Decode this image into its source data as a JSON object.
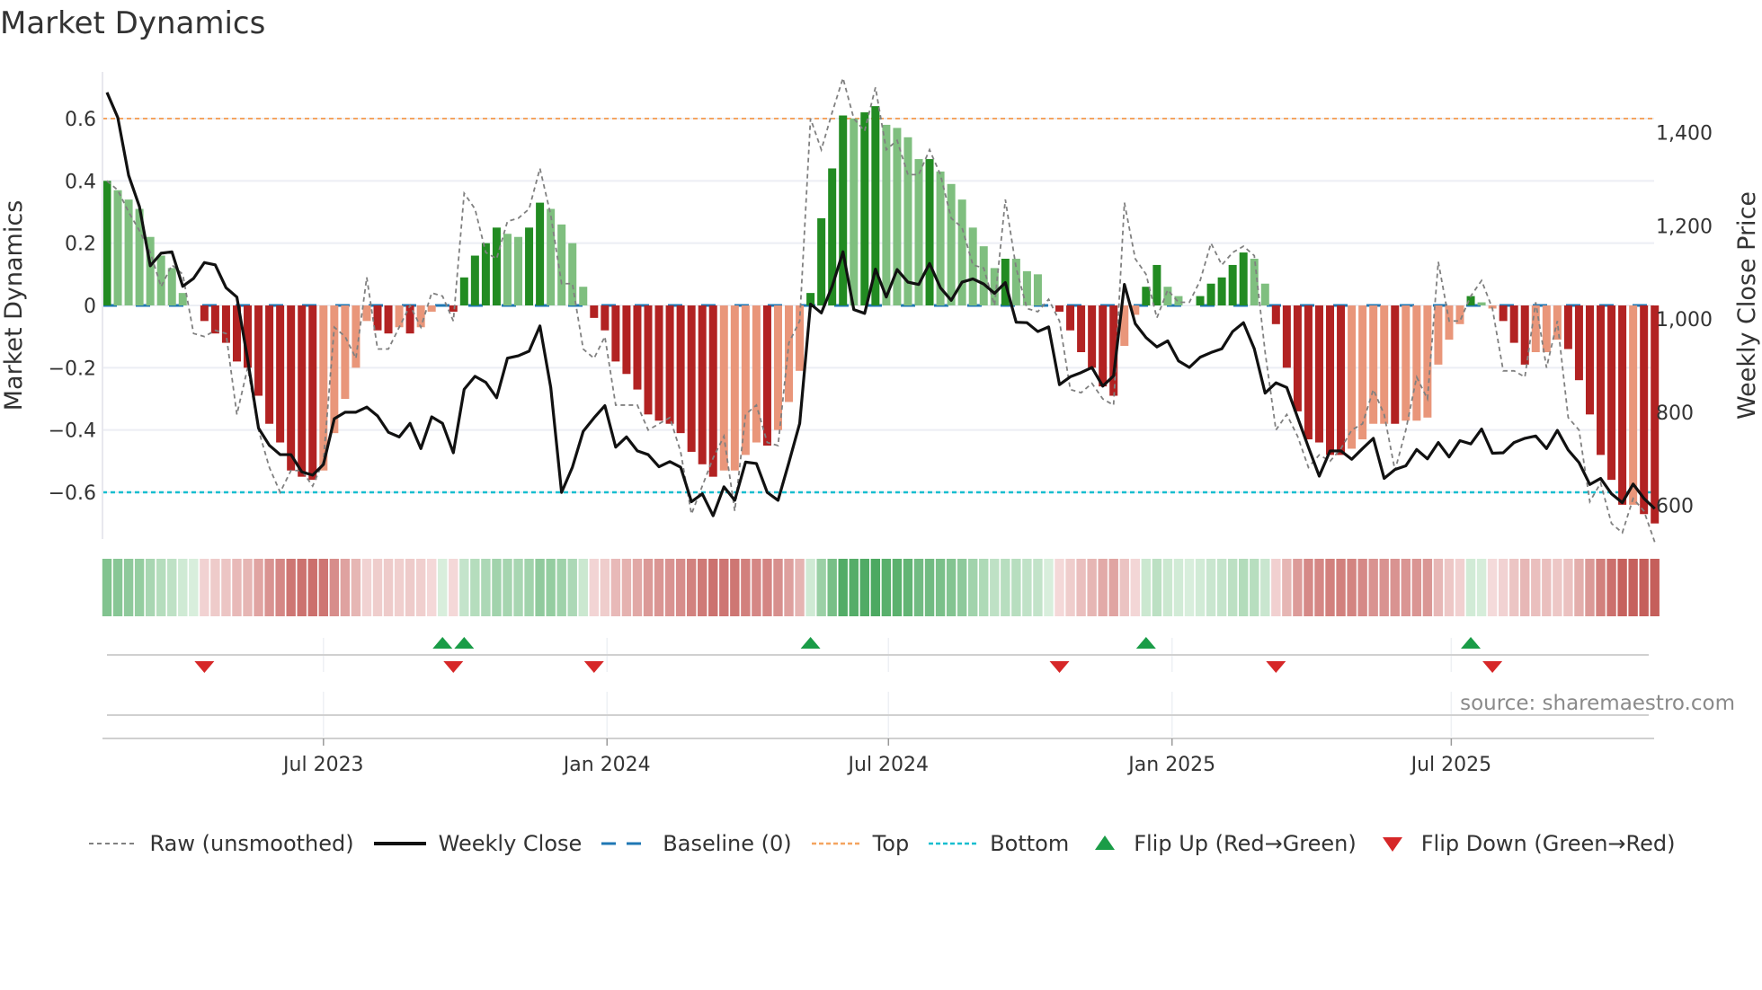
{
  "title": "Market Dynamics",
  "source": "source: sharemaestro.com",
  "legend": {
    "raw": "Raw (unsmoothed)",
    "close": "Weekly Close",
    "baseline": "Baseline (0)",
    "top": "Top",
    "bottom": "Bottom",
    "flip_up": "Flip Up (Red→Green)",
    "flip_down": "Flip Down (Green→Red)"
  },
  "colors": {
    "green_strong": "#228b22",
    "green_weak": "#7fbf7f",
    "red_strong": "#b22222",
    "red_weak": "#e9967a",
    "close": "#111111",
    "raw": "#808080",
    "baseline": "#1f77b4",
    "top": "#f4a460",
    "bottom": "#17becf",
    "flip_up": "#1a9c47",
    "flip_down": "#d62728"
  },
  "chart_data": {
    "type": "bar",
    "title": "Market Dynamics",
    "ylabel": "Market Dynamics",
    "y2label": "Weekly Close Price",
    "ylim": [
      -0.75,
      0.75
    ],
    "y2lim": [
      528,
      1530
    ],
    "yticks": [
      {
        "v": 0.6,
        "label": "0.6"
      },
      {
        "v": 0.4,
        "label": "0.4"
      },
      {
        "v": 0.2,
        "label": "0.2"
      },
      {
        "v": 0,
        "label": "0"
      },
      {
        "v": -0.2,
        "label": "−0.2"
      },
      {
        "v": -0.4,
        "label": "−0.4"
      },
      {
        "v": -0.6,
        "label": "−0.6"
      }
    ],
    "y2ticks": [
      {
        "v": 1400,
        "label": "1,400"
      },
      {
        "v": 1200,
        "label": "1,200"
      },
      {
        "v": 1000,
        "label": "1,000"
      },
      {
        "v": 800,
        "label": "800"
      },
      {
        "v": 600,
        "label": "600"
      }
    ],
    "x_ticks": [
      {
        "label": "Jul 2023",
        "week_index": 20.0
      },
      {
        "label": "Jan 2024",
        "week_index": 46.2
      },
      {
        "label": "Jul 2024",
        "week_index": 72.2
      },
      {
        "label": "Jan 2025",
        "week_index": 98.4
      },
      {
        "label": "Jul 2025",
        "week_index": 124.2
      }
    ],
    "top_level": 0.6,
    "bottom_level": -0.6,
    "baseline": 0,
    "values": [
      0.4,
      0.37,
      0.34,
      0.31,
      0.22,
      0.16,
      0.12,
      0.04,
      0,
      -0.05,
      -0.09,
      -0.12,
      -0.18,
      -0.2,
      -0.29,
      -0.38,
      -0.44,
      -0.53,
      -0.55,
      -0.56,
      -0.53,
      -0.41,
      -0.3,
      -0.2,
      -0.05,
      -0.08,
      -0.09,
      -0.07,
      -0.09,
      -0.07,
      -0.02,
      0,
      -0.02,
      0.09,
      0.16,
      0.2,
      0.25,
      0.23,
      0.22,
      0.25,
      0.33,
      0.31,
      0.26,
      0.2,
      0.06,
      -0.04,
      -0.08,
      -0.18,
      -0.22,
      -0.27,
      -0.35,
      -0.37,
      -0.38,
      -0.41,
      -0.47,
      -0.51,
      -0.55,
      -0.53,
      -0.53,
      -0.48,
      -0.44,
      -0.45,
      -0.4,
      -0.31,
      -0.21,
      0.04,
      0.28,
      0.44,
      0.61,
      0.6,
      0.62,
      0.64,
      0.58,
      0.57,
      0.54,
      0.47,
      0.47,
      0.43,
      0.39,
      0.34,
      0.25,
      0.19,
      0.12,
      0.15,
      0.15,
      0.11,
      0.1,
      0,
      -0.02,
      -0.08,
      -0.15,
      -0.2,
      -0.26,
      -0.29,
      -0.13,
      -0.03,
      0.06,
      0.13,
      0.06,
      0.03,
      0,
      0.03,
      0.07,
      0.09,
      0.13,
      0.17,
      0.15,
      0.07,
      -0.06,
      -0.2,
      -0.34,
      -0.43,
      -0.44,
      -0.48,
      -0.48,
      -0.46,
      -0.43,
      -0.38,
      -0.38,
      -0.38,
      -0.37,
      -0.37,
      -0.36,
      -0.19,
      -0.11,
      -0.06,
      0.03,
      0.01,
      -0.01,
      -0.05,
      -0.12,
      -0.19,
      -0.15,
      -0.15,
      -0.11,
      -0.14,
      -0.24,
      -0.35,
      -0.48,
      -0.56,
      -0.64,
      -0.64,
      -0.67,
      -0.7
    ],
    "strong": [
      1,
      0,
      0,
      0,
      0,
      0,
      0,
      0,
      0,
      1,
      1,
      1,
      1,
      1,
      1,
      1,
      1,
      1,
      1,
      1,
      0,
      0,
      0,
      0,
      0,
      1,
      1,
      0,
      1,
      0,
      0,
      0,
      1,
      1,
      1,
      1,
      1,
      0,
      0,
      1,
      1,
      0,
      0,
      0,
      0,
      1,
      1,
      1,
      1,
      1,
      1,
      1,
      1,
      1,
      1,
      1,
      1,
      0,
      0,
      0,
      0,
      1,
      0,
      0,
      0,
      1,
      1,
      1,
      1,
      0,
      1,
      1,
      0,
      0,
      0,
      0,
      1,
      0,
      0,
      0,
      0,
      0,
      0,
      1,
      0,
      0,
      0,
      0,
      1,
      1,
      1,
      1,
      1,
      1,
      0,
      0,
      1,
      1,
      0,
      0,
      0,
      1,
      1,
      1,
      1,
      1,
      0,
      0,
      1,
      1,
      1,
      1,
      1,
      1,
      1,
      0,
      0,
      0,
      0,
      1,
      0,
      0,
      0,
      0,
      0,
      0,
      1,
      0,
      0,
      1,
      1,
      1,
      0,
      0,
      0,
      1,
      1,
      1,
      1,
      1,
      1,
      0,
      1,
      1
    ],
    "raw": [
      0.4,
      0.37,
      0.3,
      0.24,
      0.17,
      0.06,
      0.13,
      0.1,
      -0.09,
      -0.1,
      -0.08,
      -0.09,
      -0.35,
      -0.2,
      -0.4,
      -0.52,
      -0.6,
      -0.53,
      -0.53,
      -0.58,
      -0.5,
      -0.07,
      -0.1,
      -0.17,
      0.09,
      -0.14,
      -0.14,
      -0.07,
      0.0,
      -0.07,
      0.04,
      0.03,
      -0.05,
      0.36,
      0.31,
      0.17,
      0.15,
      0.27,
      0.28,
      0.31,
      0.44,
      0.29,
      0.07,
      0.07,
      -0.14,
      -0.17,
      -0.1,
      -0.32,
      -0.32,
      -0.32,
      -0.4,
      -0.38,
      -0.36,
      -0.47,
      -0.67,
      -0.58,
      -0.49,
      -0.42,
      -0.66,
      -0.35,
      -0.32,
      -0.44,
      -0.45,
      -0.12,
      -0.05,
      0.6,
      0.5,
      0.62,
      0.73,
      0.6,
      0.56,
      0.7,
      0.5,
      0.53,
      0.42,
      0.42,
      0.5,
      0.42,
      0.28,
      0.25,
      0.13,
      0.12,
      0.0,
      0.34,
      0.12,
      -0.01,
      -0.02,
      0.02,
      -0.05,
      -0.27,
      -0.28,
      -0.25,
      -0.3,
      -0.32,
      0.33,
      0.15,
      0.1,
      -0.04,
      0.05,
      0.01,
      0.01,
      0.08,
      0.2,
      0.13,
      0.17,
      0.19,
      0.16,
      -0.15,
      -0.4,
      -0.35,
      -0.42,
      -0.52,
      -0.48,
      -0.5,
      -0.46,
      -0.4,
      -0.38,
      -0.27,
      -0.35,
      -0.53,
      -0.4,
      -0.23,
      -0.3,
      0.14,
      -0.05,
      -0.05,
      0.03,
      0.08,
      -0.01,
      -0.21,
      -0.21,
      -0.23,
      0.01,
      -0.2,
      -0.05,
      -0.36,
      -0.4,
      -0.63,
      -0.57,
      -0.7,
      -0.73,
      -0.62,
      -0.66,
      -0.76
    ],
    "close": [
      1486,
      1432,
      1308,
      1241,
      1114,
      1141,
      1144,
      1070,
      1087,
      1121,
      1116,
      1067,
      1047,
      913,
      766,
      729,
      709,
      709,
      672,
      665,
      688,
      786,
      800,
      800,
      811,
      792,
      757,
      747,
      776,
      722,
      790,
      776,
      713,
      849,
      877,
      864,
      831,
      916,
      921,
      931,
      985,
      853,
      628,
      682,
      759,
      788,
      814,
      725,
      747,
      717,
      709,
      683,
      694,
      682,
      608,
      625,
      578,
      640,
      611,
      693,
      690,
      628,
      611,
      692,
      776,
      1032,
      1013,
      1070,
      1144,
      1020,
      1012,
      1107,
      1047,
      1106,
      1079,
      1074,
      1119,
      1067,
      1040,
      1079,
      1086,
      1075,
      1055,
      1078,
      993,
      992,
      973,
      983,
      859,
      876,
      885,
      896,
      856,
      878,
      1074,
      990,
      960,
      940,
      953,
      910,
      896,
      918,
      928,
      936,
      973,
      992,
      936,
      841,
      863,
      853,
      789,
      725,
      663,
      717,
      717,
      699,
      722,
      744,
      658,
      677,
      685,
      720,
      700,
      735,
      704,
      739,
      732,
      764,
      712,
      713,
      735,
      744,
      749,
      722,
      761,
      719,
      692,
      645,
      658,
      625,
      606,
      646,
      615,
      593
    ],
    "flip_up_weeks": [
      31,
      33,
      65,
      96,
      126
    ],
    "flip_down_weeks": [
      9,
      32,
      45,
      88,
      108,
      128
    ]
  }
}
